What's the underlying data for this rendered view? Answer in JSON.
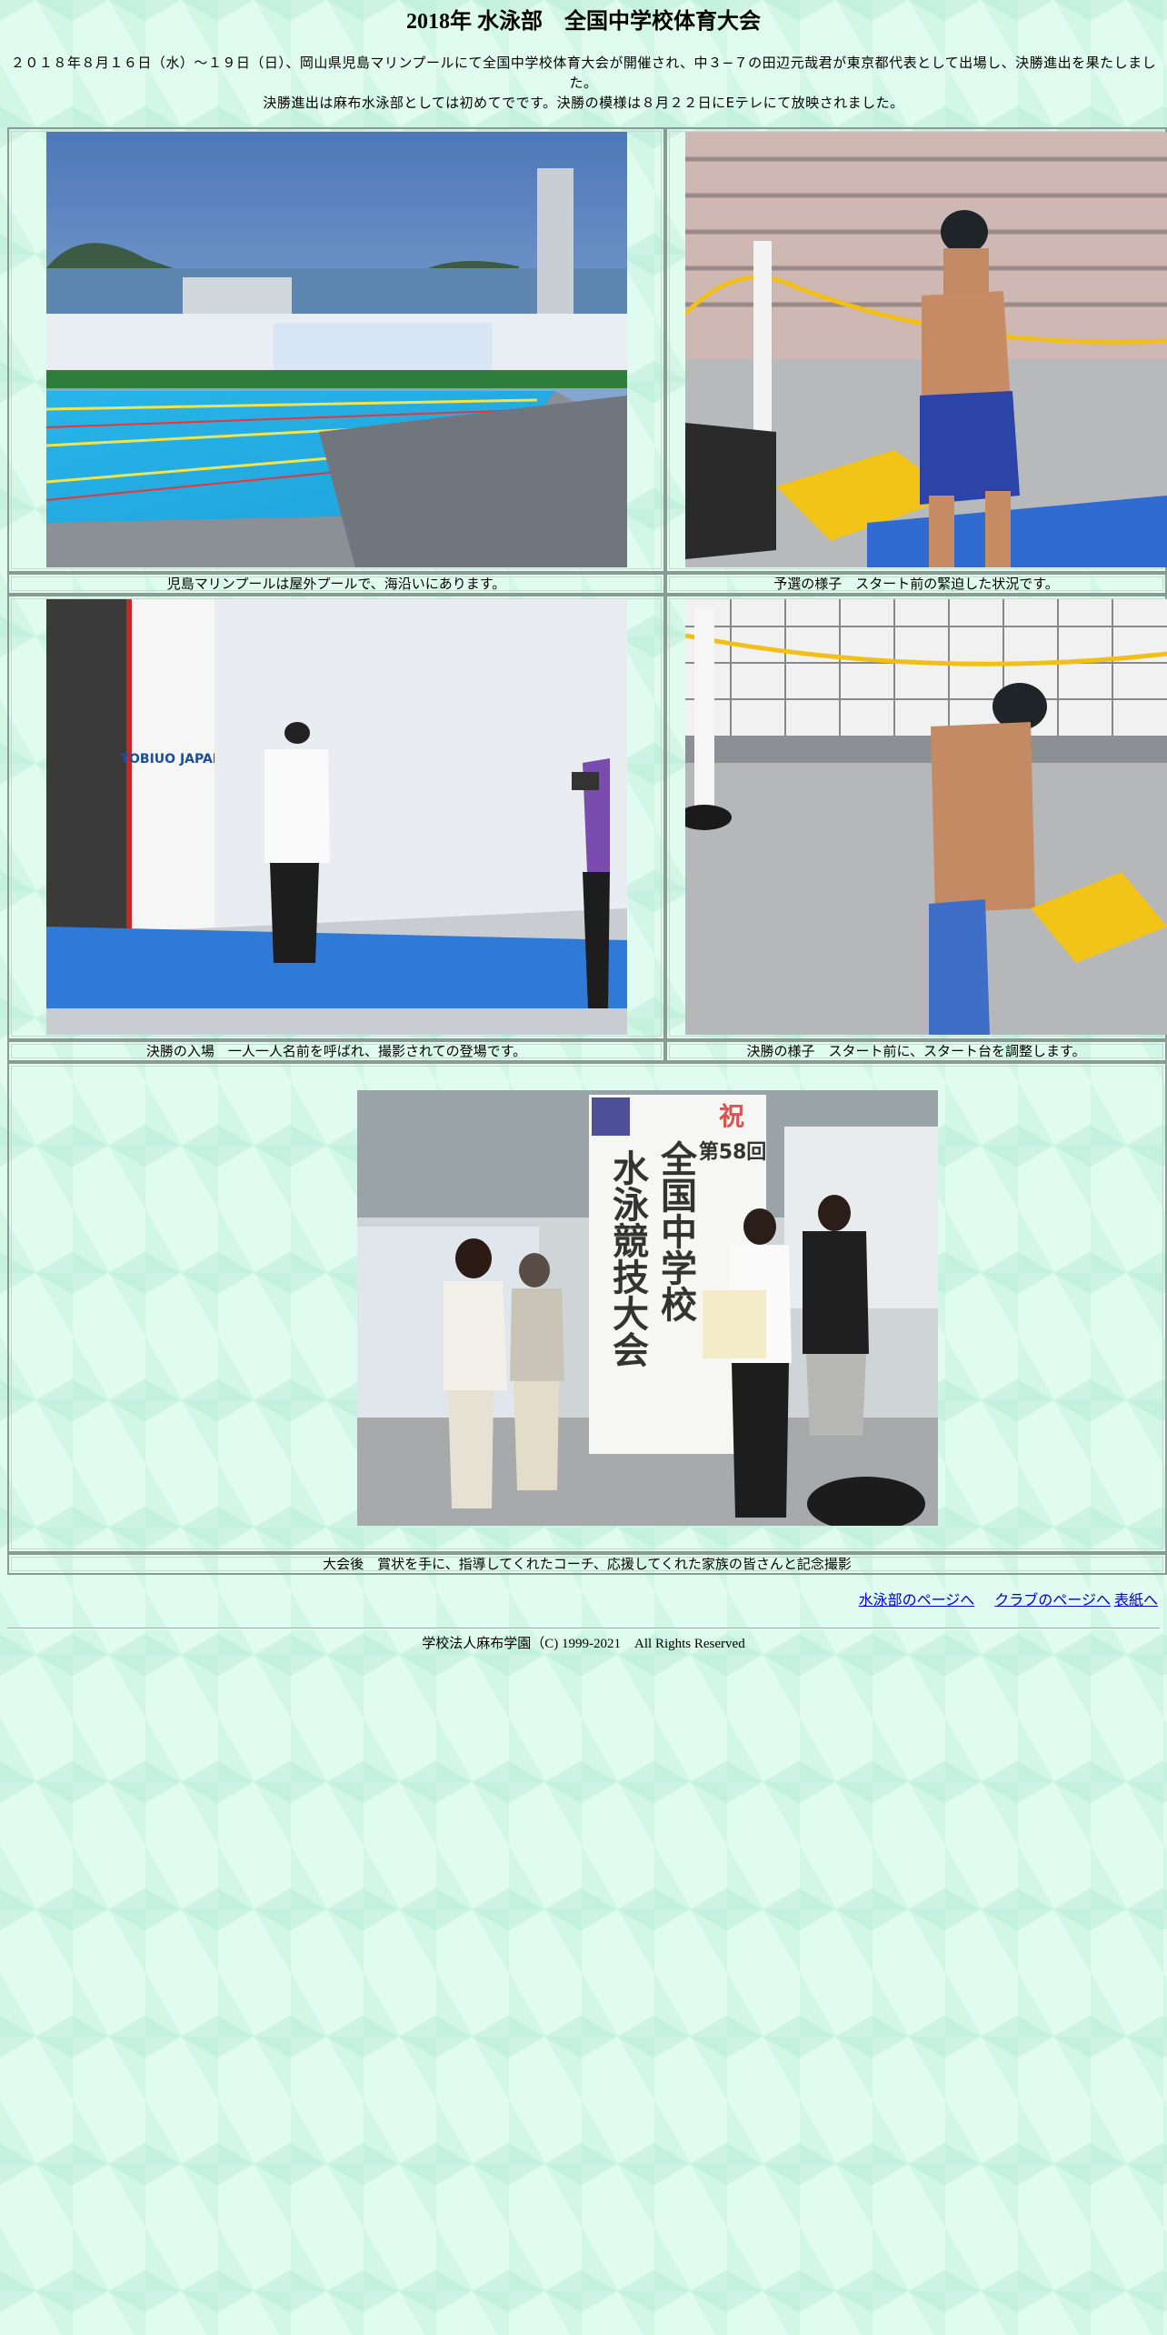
{
  "page": {
    "title": "2018年 水泳部　全国中学校体育大会",
    "intro_line1": "２０１８年８月１６日（水）～１９日（日）、岡山県児島マリンプールにて全国中学校体育大会が開催され、中３−７の田辺元哉君が東京都代表として出場し、決勝進出を果たしました。",
    "intro_line2": "決勝進出は麻布水泳部としては初めてでです。決勝の模様は８月２２日にEテレにて放映されました。"
  },
  "photos": [
    {
      "caption": "児島マリンプールは屋外プールで、海沿いにあります。"
    },
    {
      "caption": "予選の様子　スタート前の緊迫した状況です。"
    },
    {
      "caption": "決勝の入場　一人一人名前を呼ばれ、撮影されての登場です。"
    },
    {
      "caption": "決勝の様子　スタート前に、スタート台を調整します。"
    },
    {
      "caption": "大会後　賞状を手に、指導してくれたコーチ、応援してくれた家族の皆さんと記念撮影"
    }
  ],
  "photo_text": {
    "banner_celebrate": "祝",
    "banner_edition": "第58回",
    "banner_title1": "全国中学校",
    "banner_title2": "水泳競技大会",
    "tobiuo": "TOBIUO JAPAN"
  },
  "footer": {
    "links": [
      "水泳部のページへ",
      "クラブのページへ",
      "表紙へ"
    ],
    "copyright": "学校法人麻布学園（C) 1999-2021　All Rights Reserved"
  },
  "colors": {
    "background": "#e0fbf0",
    "link": "#0000cc"
  }
}
